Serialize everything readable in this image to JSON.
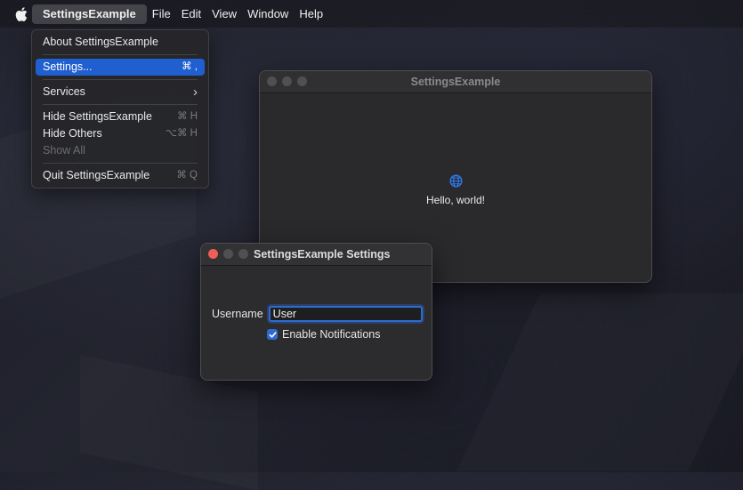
{
  "menubar": {
    "app_name": "SettingsExample",
    "items": [
      "File",
      "Edit",
      "View",
      "Window",
      "Help"
    ]
  },
  "app_menu": {
    "about": "About SettingsExample",
    "settings": "Settings...",
    "settings_shortcut": "⌘ ,",
    "services": "Services",
    "services_arrow": "›",
    "hide": "Hide SettingsExample",
    "hide_shortcut": "⌘ H",
    "hide_others": "Hide Others",
    "hide_others_shortcut": "⌥⌘ H",
    "show_all": "Show All",
    "quit": "Quit SettingsExample",
    "quit_shortcut": "⌘ Q"
  },
  "main_window": {
    "title": "SettingsExample",
    "icon": "globe-icon",
    "message": "Hello, world!"
  },
  "settings_window": {
    "title": "SettingsExample Settings",
    "username_label": "Username",
    "username_value": "User",
    "notifications_label": "Enable Notifications",
    "notifications_checked": true
  },
  "colors": {
    "accent": "#1f5fd0",
    "close": "#ed5f57"
  }
}
